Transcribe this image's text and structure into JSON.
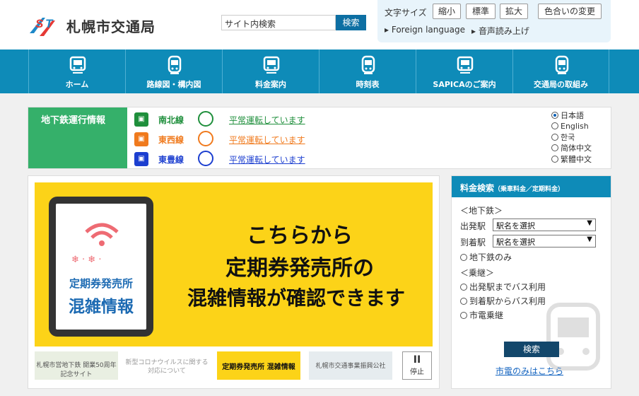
{
  "header": {
    "logo_mark": "ST",
    "logo_text": "札幌市交通局",
    "search_placeholder": "サイト内検索",
    "search_button": "検索",
    "text_size_label": "文字サイズ",
    "shrink": "縮小",
    "standard": "標準",
    "enlarge": "拡大",
    "color_change": "色合いの変更",
    "foreign_language": "Foreign language",
    "read_aloud": "音声読み上げ"
  },
  "nav": {
    "items": [
      {
        "label": "ホーム",
        "icon": "home-icon"
      },
      {
        "label": "路線図・構内図",
        "icon": "route-map-icon"
      },
      {
        "label": "料金案内",
        "icon": "fare-icon"
      },
      {
        "label": "時刻表",
        "icon": "timetable-icon"
      },
      {
        "label": "SAPICAのご案内",
        "icon": "sapica-icon"
      },
      {
        "label": "交通局の取組み",
        "icon": "initiatives-icon"
      }
    ]
  },
  "subway": {
    "label": "地下鉄運行情報",
    "lines": [
      {
        "name": "南北線",
        "status": "平常運転しています",
        "color": "#1f8f3c"
      },
      {
        "name": "東西線",
        "status": "平常運転しています",
        "color": "#f07a1d"
      },
      {
        "name": "東豊線",
        "status": "平常運転しています",
        "color": "#1c3fd0"
      }
    ],
    "languages": [
      "日本語",
      "English",
      "한국",
      "简体中文",
      "繁體中文"
    ]
  },
  "banner": {
    "tablet_line1": "定期券発売所",
    "tablet_line2": "混雑情報",
    "line1": "こちらから",
    "line2": "定期券発売所の",
    "line3": "混雑情報が確認できます",
    "accent": "#fcd318",
    "thumb1": "札幌市営地下鉄 開業50周年記念サイト",
    "thumb2": "新型コロナウイルスに関する対応について",
    "thumb3": "定期券発売所 混雑情報",
    "thumb4": "札幌市交通事業振興公社",
    "pause": "停止",
    "pause_symbol": "II"
  },
  "fare": {
    "title": "料金検索",
    "subtitle": "（乗車料金／定期料金）",
    "subway_heading": "＜地下鉄＞",
    "departure_label": "出発駅",
    "arrival_label": "到着駅",
    "station_placeholder": "駅名を選択",
    "subway_only": "地下鉄のみ",
    "transfer_heading": "＜乗継＞",
    "bus_to_departure": "出発駅までバス利用",
    "bus_from_arrival": "到着駅からバス利用",
    "streetcar_transfer": "市電乗継",
    "search_button": "検索",
    "streetcar_only": "市電のみはこちら"
  }
}
